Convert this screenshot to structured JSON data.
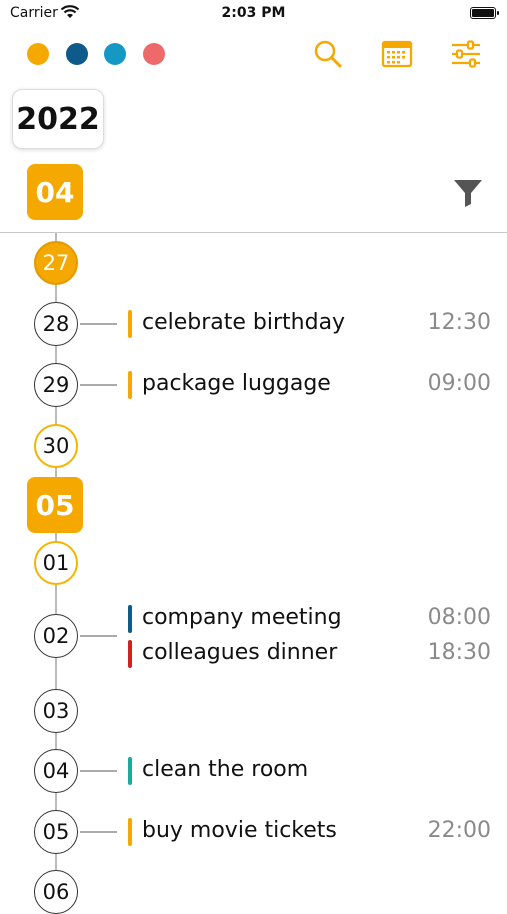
{
  "status_bar": {
    "carrier": "Carrier",
    "time": "2:03 PM"
  },
  "color_filters": [
    {
      "name": "yellow",
      "color": "#f5a800"
    },
    {
      "name": "dark-blue",
      "color": "#0e5a8a"
    },
    {
      "name": "cyan",
      "color": "#1598c4"
    },
    {
      "name": "red",
      "color": "#ee6a6a"
    }
  ],
  "toolbar": {
    "icons": [
      "search-icon",
      "calendar-icon",
      "sliders-icon"
    ],
    "accent": "#f5a800"
  },
  "year": "2022",
  "months": [
    "04",
    "05"
  ],
  "days": [
    "27",
    "28",
    "29",
    "30",
    "01",
    "02",
    "03",
    "04",
    "05",
    "06"
  ],
  "events": [
    {
      "day": "28",
      "title": "celebrate birthday",
      "time": "12:30",
      "color": "#f5a800"
    },
    {
      "day": "29",
      "title": "package luggage",
      "time": "09:00",
      "color": "#f5a800"
    },
    {
      "day": "02",
      "title": "company meeting",
      "time": "08:00",
      "color": "#0e5a8a"
    },
    {
      "day": "02",
      "title": "colleagues dinner",
      "time": "18:30",
      "color": "#d42020"
    },
    {
      "day": "04",
      "title": "clean the room",
      "time": "",
      "color": "#1aab9a"
    },
    {
      "day": "05",
      "title": "buy movie tickets",
      "time": "22:00",
      "color": "#f5a800"
    }
  ]
}
